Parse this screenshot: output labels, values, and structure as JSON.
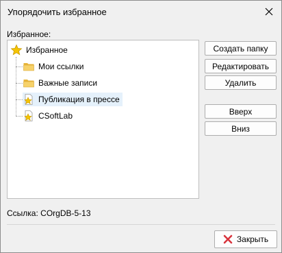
{
  "window": {
    "title": "Упорядочить избранное"
  },
  "tree": {
    "label": "Избранное:",
    "root": {
      "label": "Избранное",
      "icon": "star-icon"
    },
    "children": [
      {
        "label": "Мои ссылки",
        "icon": "folder-icon"
      },
      {
        "label": "Важные записи",
        "icon": "folder-icon"
      },
      {
        "label": "Публикация в прессе",
        "icon": "star-document-icon",
        "selected": true
      },
      {
        "label": "CSoftLab",
        "icon": "star-document-icon"
      }
    ]
  },
  "buttons": {
    "create_folder": "Создать папку",
    "edit": "Редактировать",
    "delete": "Удалить",
    "up": "Вверх",
    "down": "Вниз"
  },
  "link": {
    "prefix": "Ссылка: ",
    "value": "COrgDB-5-13"
  },
  "footer": {
    "close_label": "Закрыть"
  },
  "colors": {
    "selection": "#e5f1fb",
    "folder": "#f3c642",
    "star": "#f5c400",
    "close_x": "#d8343d"
  }
}
